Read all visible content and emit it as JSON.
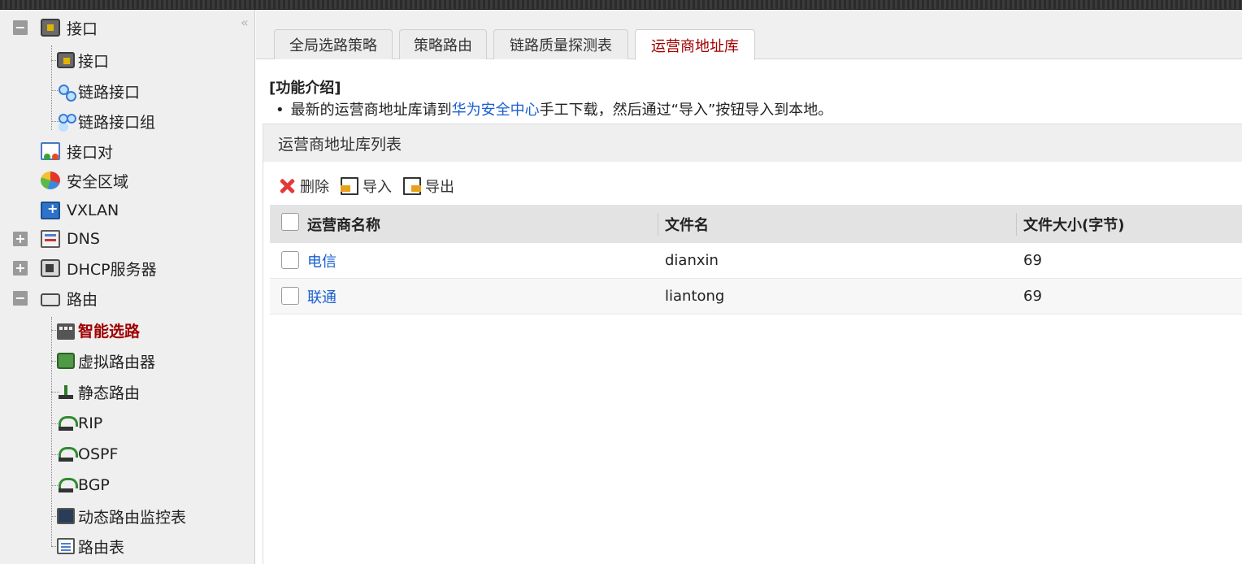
{
  "sidebar": {
    "collapse_icon": "double-chevron-left-icon",
    "items": [
      {
        "label": "接口",
        "icon": "interface-icon",
        "toggle": "−"
      },
      {
        "label": "接口",
        "icon": "interface-icon"
      },
      {
        "label": "链路接口",
        "icon": "link-interface-icon"
      },
      {
        "label": "链路接口组",
        "icon": "link-interface-group-icon"
      },
      {
        "label": "接口对",
        "icon": "interface-pair-icon"
      },
      {
        "label": "安全区域",
        "icon": "security-zone-icon"
      },
      {
        "label": "VXLAN",
        "icon": "vxlan-icon"
      },
      {
        "label": "DNS",
        "icon": "dns-icon",
        "toggle": "+"
      },
      {
        "label": "DHCP服务器",
        "icon": "dhcp-server-icon",
        "toggle": "+"
      },
      {
        "label": "路由",
        "icon": "route-icon",
        "toggle": "−"
      },
      {
        "label": "智能选路",
        "icon": "smart-routing-icon"
      },
      {
        "label": "虚拟路由器",
        "icon": "virtual-router-icon"
      },
      {
        "label": "静态路由",
        "icon": "static-route-icon"
      },
      {
        "label": "RIP",
        "icon": "rip-icon"
      },
      {
        "label": "OSPF",
        "icon": "ospf-icon"
      },
      {
        "label": "BGP",
        "icon": "bgp-icon"
      },
      {
        "label": "动态路由监控表",
        "icon": "dynamic-route-monitor-icon"
      },
      {
        "label": "路由表",
        "icon": "routing-table-icon"
      }
    ]
  },
  "tabs": [
    {
      "label": "全局选路策略"
    },
    {
      "label": "策略路由"
    },
    {
      "label": "链路质量探测表"
    },
    {
      "label": "运营商地址库"
    }
  ],
  "intro": {
    "title": "[功能介绍]",
    "bullet": "•",
    "text_before": "最新的运营商地址库请到",
    "link": "华为安全中心",
    "text_after": "手工下载，然后通过“导入”按钮导入到本地。"
  },
  "panel": {
    "title": "运营商地址库列表",
    "toolbar": {
      "delete_label": "删除",
      "import_label": "导入",
      "export_label": "导出"
    },
    "table": {
      "headers": [
        "运营商名称",
        "文件名",
        "文件大小(字节)"
      ],
      "rows": [
        {
          "name": "电信",
          "file": "dianxin",
          "size": "69"
        },
        {
          "name": "联通",
          "file": "liantong",
          "size": "69"
        }
      ]
    }
  },
  "colors": {
    "active": "#a00000",
    "link": "#1a5fd0"
  }
}
